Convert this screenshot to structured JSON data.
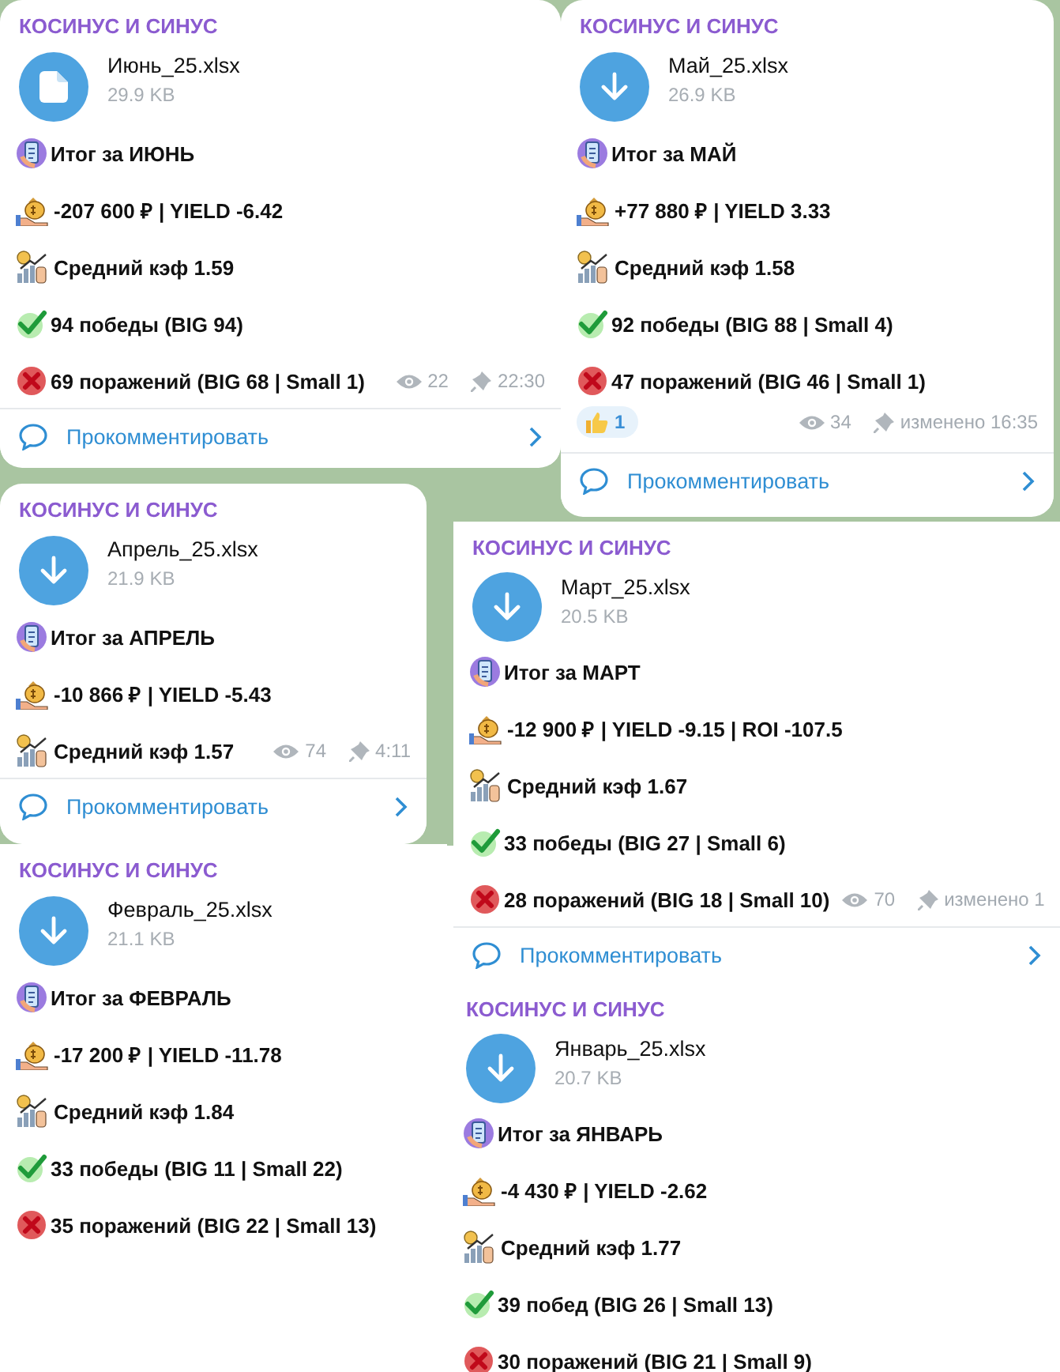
{
  "posts": [
    {
      "channel": "КОСИНУС И СИНУС",
      "file": {
        "kind": "document",
        "name": "Июнь_25.xlsx",
        "size": "29.9 KB"
      },
      "lines": [
        {
          "kind": "summary",
          "text": "Итог за ИЮНЬ"
        },
        {
          "kind": "money",
          "text": "-207 600 ₽ | YIELD -6.42"
        },
        {
          "kind": "chart",
          "text": "Средний кэф 1.59"
        },
        {
          "kind": "win",
          "text": "94 победы (BIG 94)"
        },
        {
          "kind": "loss",
          "text": "69 поражений (BIG 68 | Small 1)"
        }
      ],
      "meta": {
        "views": "22",
        "time": "22:30"
      },
      "comment": "Прокомментировать"
    },
    {
      "channel": "КОСИНУС И СИНУС",
      "file": {
        "kind": "download",
        "name": "Май_25.xlsx",
        "size": "26.9 KB"
      },
      "lines": [
        {
          "kind": "summary",
          "text": "Итог за МАЙ"
        },
        {
          "kind": "money",
          "text": "+77 880 ₽ | YIELD 3.33"
        },
        {
          "kind": "chart",
          "text": "Средний кэф 1.58"
        },
        {
          "kind": "win",
          "text": "92 победы (BIG 88 | Small 4)"
        },
        {
          "kind": "loss",
          "text": "47 поражений (BIG 46 | Small 1)"
        }
      ],
      "reaction": {
        "kind": "thumbs_up",
        "count": "1"
      },
      "meta": {
        "views": "34",
        "time": "изменено 16:35"
      },
      "comment": "Прокомментировать"
    },
    {
      "channel": "КОСИНУС И СИНУС",
      "file": {
        "kind": "download",
        "name": "Апрель_25.xlsx",
        "size": "21.9 KB"
      },
      "lines": [
        {
          "kind": "summary",
          "text": "Итог за АПРЕЛЬ"
        },
        {
          "kind": "money",
          "text": "-10 866 ₽ | YIELD -5.43"
        },
        {
          "kind": "chart",
          "text": "Средний кэф 1.57"
        }
      ],
      "meta": {
        "views": "74",
        "time": "4:11"
      },
      "comment": "Прокомментировать"
    },
    {
      "channel": "КОСИНУС И СИНУС",
      "file": {
        "kind": "download",
        "name": "Март_25.xlsx",
        "size": "20.5 KB"
      },
      "lines": [
        {
          "kind": "summary",
          "text": "Итог за МАРТ"
        },
        {
          "kind": "money",
          "text": "-12 900 ₽ | YIELD -9.15 | ROI -107.5"
        },
        {
          "kind": "chart",
          "text": "Средний кэф 1.67"
        },
        {
          "kind": "win",
          "text": "33 победы (BIG 27 | Small 6)"
        },
        {
          "kind": "loss",
          "text": "28 поражений (BIG 18 | Small 10)"
        }
      ],
      "meta": {
        "views": "70",
        "time": "изменено 1"
      },
      "comment": "Прокомментировать"
    },
    {
      "channel": "КОСИНУС И СИНУС",
      "file": {
        "kind": "download",
        "name": "Февраль_25.xlsx",
        "size": "21.1 KB"
      },
      "lines": [
        {
          "kind": "summary",
          "text": "Итог за ФЕВРАЛЬ"
        },
        {
          "kind": "money",
          "text": "-17 200 ₽ | YIELD -11.78"
        },
        {
          "kind": "chart",
          "text": "Средний кэф 1.84"
        },
        {
          "kind": "win",
          "text": "33 победы (BIG 11 | Small 22)"
        },
        {
          "kind": "loss",
          "text": "35 поражений (BIG 22 | Small 13)"
        }
      ]
    },
    {
      "channel": "КОСИНУС И СИНУС",
      "file": {
        "kind": "download",
        "name": "Январь_25.xlsx",
        "size": "20.7 KB"
      },
      "lines": [
        {
          "kind": "summary",
          "text": "Итог за ЯНВАРЬ"
        },
        {
          "kind": "money",
          "text": "-4 430 ₽ | YIELD -2.62"
        },
        {
          "kind": "chart",
          "text": "Средний кэф 1.77"
        },
        {
          "kind": "win",
          "text": "39 побед (BIG 26 | Small 13)"
        },
        {
          "kind": "loss",
          "text": "30 поражений (BIG 21 | Small 9)"
        }
      ]
    }
  ]
}
